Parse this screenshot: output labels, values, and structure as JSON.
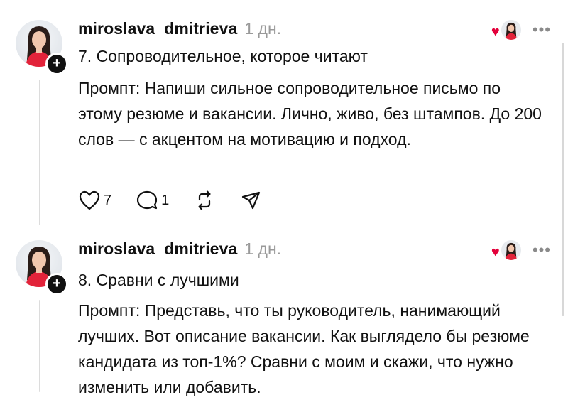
{
  "posts": [
    {
      "username": "miroslava_dmitrieva",
      "time": "1 дн.",
      "title": "7. Сопроводительное, которое читают",
      "body": "Промпт: Напиши сильное сопроводительное письмо по этому резюме и вакансии. Лично, живо, без штампов. До 200 слов — с акцентом на мотивацию и подход.",
      "likes": "7",
      "replies": "1",
      "icons": [
        "heart-icon",
        "comment-icon",
        "repost-icon",
        "share-icon"
      ]
    },
    {
      "username": "miroslava_dmitrieva",
      "time": "1 дн.",
      "title": "8. Сравни с лучшими",
      "body": "Промпт: Представь, что ты руководитель, нанимающий лучших. Вот описание вакансии. Как выглядело бы резюме кандидата из топ-1%? Сравни с моим и скажи, что нужно изменить или добавить."
    }
  ],
  "colors": {
    "liked_heart": "#e3003a",
    "text": "#111111",
    "muted": "#9a9a9a"
  }
}
